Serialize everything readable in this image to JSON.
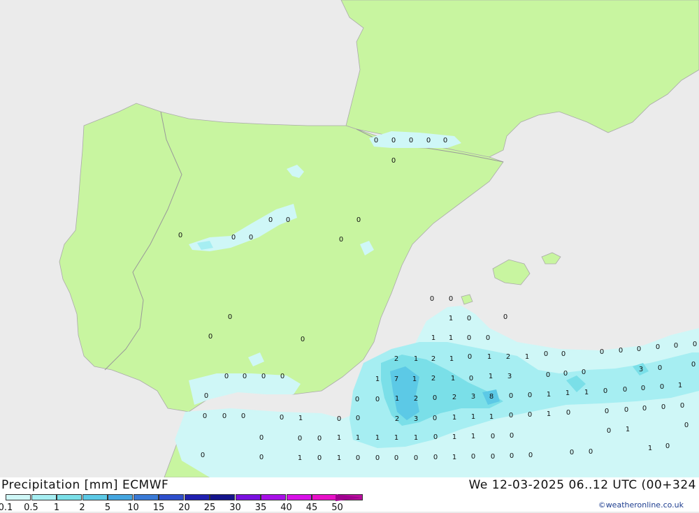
{
  "title": "Precipitation [mm] ECMWF",
  "validity": "We 12-03-2025 06..12 UTC (00+324",
  "credit": "©weatheronline.co.uk",
  "colors": {
    "sea": "#ebebeb",
    "land": "#c8f5a0",
    "border": "#999999",
    "precip_light": "#cff7f7",
    "precip_mid": "#a6eef2",
    "precip_heavy": "#5cc9e6"
  },
  "legend": [
    {
      "label": "0.1",
      "color": "#cff7f7"
    },
    {
      "label": "0.5",
      "color": "#a6eef2"
    },
    {
      "label": "1",
      "color": "#7adfe8"
    },
    {
      "label": "2",
      "color": "#5cc9e6"
    },
    {
      "label": "5",
      "color": "#45a6e0"
    },
    {
      "label": "10",
      "color": "#3a7ad6"
    },
    {
      "label": "15",
      "color": "#2e4fcc"
    },
    {
      "label": "20",
      "color": "#2020b0"
    },
    {
      "label": "25",
      "color": "#14148c"
    },
    {
      "label": "30",
      "color": "#7a10e0"
    },
    {
      "label": "35",
      "color": "#a810e8"
    },
    {
      "label": "40",
      "color": "#d810e8"
    },
    {
      "label": "45",
      "color": "#e810c8"
    },
    {
      "label": "50",
      "color": "#b8109c"
    }
  ]
}
